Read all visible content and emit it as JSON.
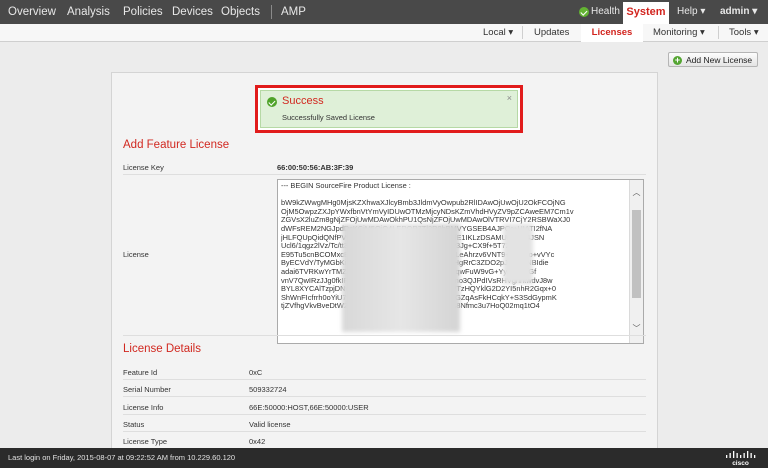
{
  "topnav": {
    "items": [
      "Overview",
      "Analysis",
      "Policies",
      "Devices",
      "Objects",
      "AMP"
    ],
    "health": "Health",
    "system": "System",
    "help": "Help ▾",
    "user": "admin ▾"
  },
  "subnav": {
    "items": [
      "Local ▾",
      "Updates",
      "Licenses",
      "Monitoring ▾",
      "Tools ▾"
    ],
    "active": "Licenses"
  },
  "add_button": "Add New License",
  "alert": {
    "title": "Success",
    "message": "Successfully Saved License",
    "close": "×"
  },
  "add_feature": {
    "title": "Add Feature License",
    "license_key_label": "License Key",
    "license_key_value": "66:00:50:56:AB:3F:39",
    "license_label": "License",
    "license_text": "--- BEGIN SourceFire Product License :\n\nbW9kZWwgMHg0MjsKZXhwaXJlcyBmb3JldmVyOwpub2RlIDAwOjUwOjU2OkFCOjNG\nOjM5OwpzZXJpYWxfbnVtYmVyIDUwOTMzMjcyNDsKZmVhdHVyZV9pZCAweEM7Cm1v\nZGVsX2luZm8gNjZFOjUwMDAwOkhPU1QsNjZFOjUwMDAwOlVTRVI7CjY2RSBWaXJ0\ndWFsREM2NGJpdDsKCjM5OjQ4LERQR7Tl2R0hBMVYGSEB4AJPQr+UIATI2fNA\njHLFQUpQidQNfPVv0NqKu8RDSMnm2Aa5HqfcMHjfE1IKLzDSAMUdpCQ4JSN\nUcl6/1qgz2lVz/Tc/tt3Q6fHyEzR7DmvqRhUOkD5sZqv3Jg+CX9f+5T72JU\nE95Tu5cnBCOMxcEeT7PbN0YmaQgBRAuKsGYHmLeAhrzv6VNT9+suncljo+vVYc\nByECVdY/TyMGbKi7y1M0H2SmfqDTuaevFLt7u3KBHgRrC3ZDO2pJQiGDNBIdie\nadai6TVRKwYrTMZvaDnTkMrMbqH0OCF6x7Ux2BNqwFuW9vG+YyfsUMIfGf\nvnV7QwIRzJJg0fkIF3F16kYzMfvW8qbjRszWJPpdmmo3QJPdIVsRHVghhtwdvJ8w\nBYL8XYCAlTzpjDNwVH/Xb3Ok4X1jwUaQBjbGyJFWTzHQYklG2D2YI5nhR2Gqx+0\nShWnFIcfrrh0oYiU7y2b6KOAOJoUhrCXi+S9L4BD0xGZqAsFkHCqkY+S3SdGypmK\ntjZVfhgVkvBveDtW2BCq0xLfzKyd3lvybkSc5yJDKZ8s8Nfmc3u7HoQ02mq1tO4"
  },
  "license_details": {
    "title": "License Details",
    "rows": [
      {
        "label": "Feature Id",
        "value": "0xC"
      },
      {
        "label": "Serial Number",
        "value": "509332724"
      },
      {
        "label": "License Info",
        "value": "66E:50000:HOST,66E:50000:USER"
      },
      {
        "label": "Status",
        "value": "Valid license"
      },
      {
        "label": "License Type",
        "value": "0x42"
      }
    ]
  },
  "footer": {
    "text": "Last login on Friday, 2015-08-07 at 09:22:52 AM from 10.229.60.120",
    "logo": "cisco"
  },
  "colors": {
    "topbar": "#494949",
    "accent_red": "#d2241e",
    "success_bg": "#dff0d8",
    "alert_border": "#e11b1b"
  }
}
